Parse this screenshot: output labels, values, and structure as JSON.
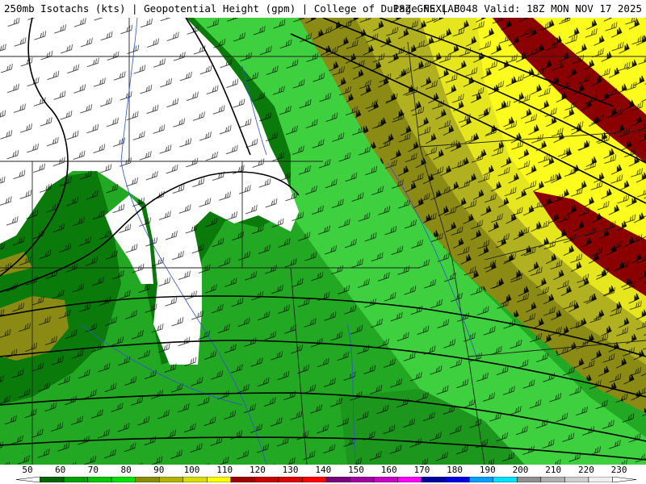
{
  "header": {
    "product": "250mb Isotachs (kts)",
    "field": "Geopotential Height (gpm)",
    "source": "College of DuPage NEXLAB",
    "run": "18Z GFS",
    "forecast_hour": "F048",
    "valid": "Valid: 18Z MON NOV 17 2025"
  },
  "legend": {
    "labels": [
      "50",
      "60",
      "70",
      "80",
      "90",
      "100",
      "110",
      "120",
      "130",
      "140",
      "150",
      "160",
      "170",
      "180",
      "190",
      "200",
      "210",
      "220",
      "230"
    ],
    "colors": [
      "#006400",
      "#00a000",
      "#00c800",
      "#00e000",
      "#8c8c00",
      "#b4b400",
      "#dcdc00",
      "#ffff00",
      "#a00000",
      "#c80000",
      "#e00000",
      "#ff0000",
      "#780078",
      "#a000a0",
      "#c800c8",
      "#ff00ff",
      "#0000a0",
      "#0000e0",
      "#00a0ff",
      "#00e0ff",
      "#909090",
      "#b0b0b0",
      "#d0d0d0",
      "#f0f0f0"
    ]
  },
  "map": {
    "shading": {
      "below_50": "#ffffff",
      "50_60": "#0a7a0a",
      "60_70": "#22a822",
      "70_80": "#3fd03f",
      "80_90": "#7a7a10",
      "90_100": "#b0b020",
      "100_110": "#e6e61e",
      "110_120": "#fbfb1e",
      "120_130": "#8b0000"
    },
    "overlays": [
      "wind-barbs",
      "height-contours",
      "state-borders",
      "rivers"
    ]
  }
}
